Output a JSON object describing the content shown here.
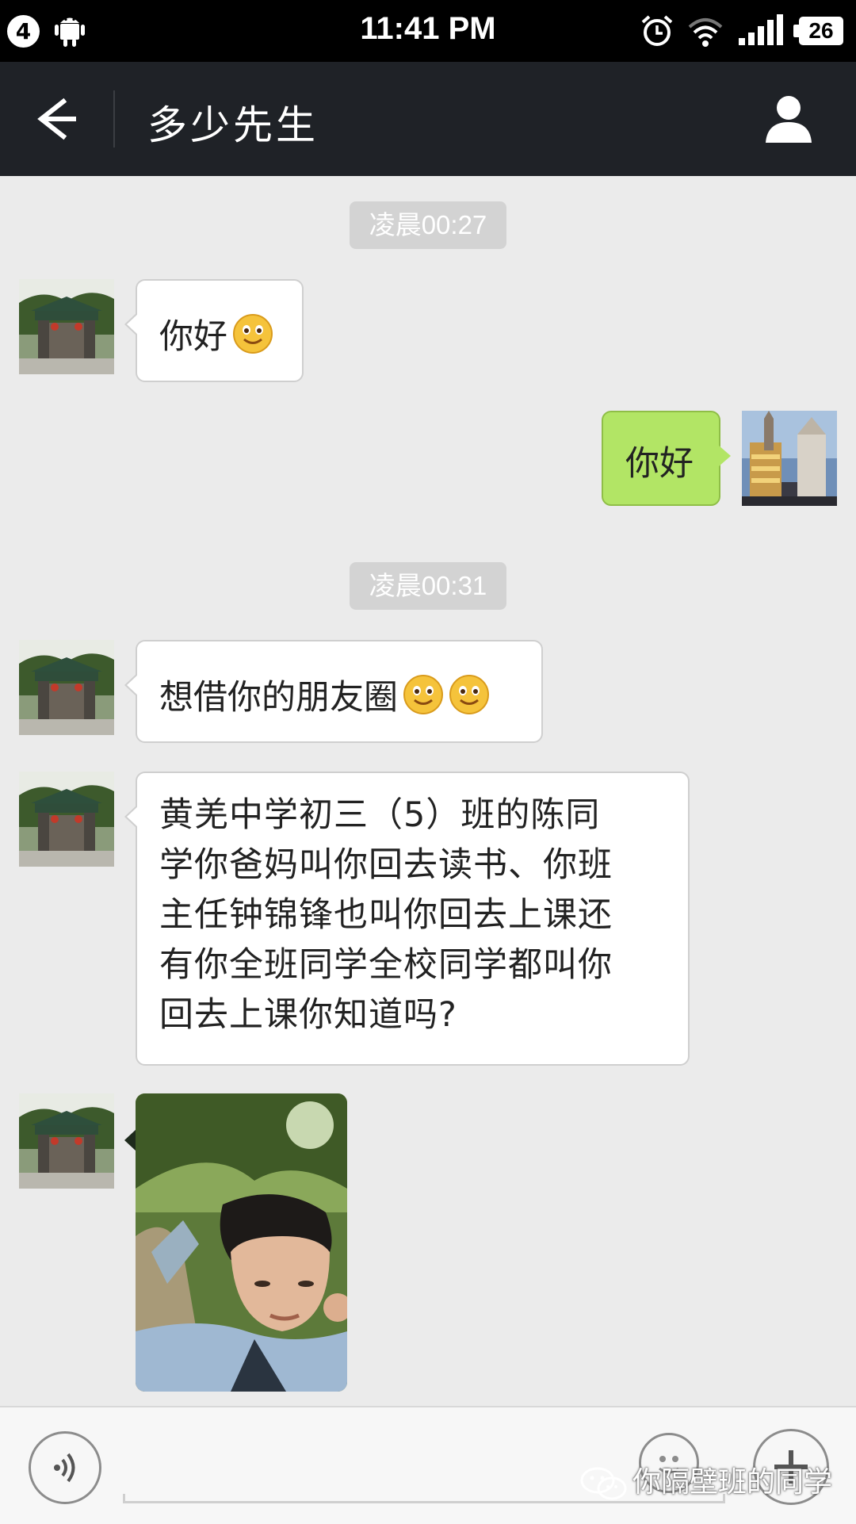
{
  "status_bar": {
    "notification_count": "4",
    "time": "11:41 PM",
    "battery": "26",
    "icons": [
      "android-icon",
      "alarm-icon",
      "wifi-icon",
      "signal-icon",
      "battery-icon"
    ]
  },
  "header": {
    "title": "多少先生",
    "back_icon": "arrow-left-icon",
    "profile_icon": "person-icon",
    "background": "#1f2227"
  },
  "messages": [
    {
      "type": "timestamp",
      "text": "凌晨00:27"
    },
    {
      "type": "text",
      "side": "left",
      "text": "你好",
      "emoji_count": 1
    },
    {
      "type": "text",
      "side": "right",
      "text": "你好",
      "emoji_count": 0
    },
    {
      "type": "timestamp",
      "text": "凌晨00:31"
    },
    {
      "type": "text",
      "side": "left",
      "text": "想借你的朋友圈",
      "emoji_count": 2
    },
    {
      "type": "text",
      "side": "left",
      "text": "黄羌中学初三（5）班的陈同学你爸妈叫你回去读书、你班主任钟锦锋也叫你回去上课还有你全班同学全校同学都叫你回去上课你知道吗?",
      "emoji_count": 0
    },
    {
      "type": "image",
      "side": "left"
    }
  ],
  "input_bar": {
    "voice_icon": "voice-icon",
    "emoji_icon": "smiley-icon",
    "plus_icon": "plus-icon"
  },
  "watermark": {
    "text": "你隔壁班的同学"
  },
  "colors": {
    "chat_background": "#ebebeb",
    "sent_bubble": "#b2e565",
    "received_bubble": "#ffffff"
  }
}
